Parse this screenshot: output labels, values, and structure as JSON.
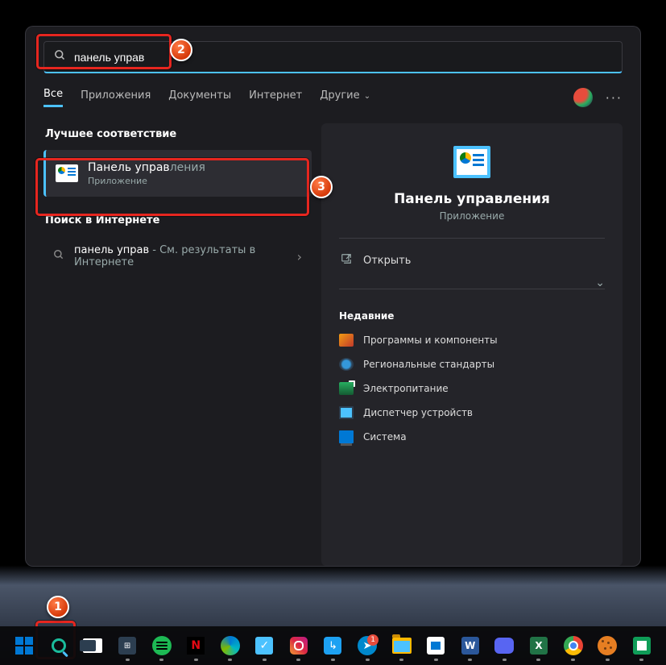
{
  "search": {
    "value": "панель управ"
  },
  "tabs": {
    "all": "Все",
    "apps": "Приложения",
    "docs": "Документы",
    "web": "Интернет",
    "more": "Другие"
  },
  "left": {
    "best_match": "Лучшее соответствие",
    "result": {
      "title_match": "Панель управ",
      "title_rest": "ления",
      "subtitle": "Приложение"
    },
    "web_section": "Поиск в Интернете",
    "web_item": {
      "query": "панель управ",
      "suffix": " - См. результаты в Интернете"
    }
  },
  "detail": {
    "title": "Панель управления",
    "subtitle": "Приложение",
    "open": "Открыть",
    "recent_label": "Недавние",
    "recent": [
      "Программы и компоненты",
      "Региональные стандарты",
      "Электропитание",
      "Диспетчер устройств",
      "Система"
    ]
  },
  "annotations": {
    "n1": "1",
    "n2": "2",
    "n3": "3"
  },
  "taskbar": {
    "telegram_badge": "1",
    "netflix": "N",
    "twitter": "↳",
    "telegram": "➤",
    "word": "W",
    "excel": "X",
    "calc": "⊞"
  }
}
